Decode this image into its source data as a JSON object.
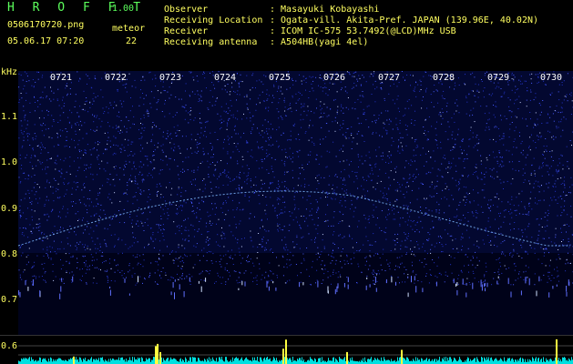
{
  "header": {
    "app_title": "H R O F F T",
    "app_version": "1.00",
    "filename": "0506170720.png",
    "datetime": "05.06.17 07:20",
    "meteor_label": "meteor",
    "meteor_count": "22"
  },
  "info": [
    {
      "label": "Observer",
      "value": ": Masayuki Kobayashi"
    },
    {
      "label": "Receiving Location",
      "value": ": Ogata-vill. Akita-Pref. JAPAN (139.96E, 40.02N)"
    },
    {
      "label": "Receiver",
      "value": ": ICOM IC-575 53.7492(@LCD)MHz USB"
    },
    {
      "label": "Receiving antenna",
      "value": ": A504HB(yagi 4el)"
    }
  ],
  "axis": {
    "unit": "kHz",
    "y_ticks": [
      "1.1",
      "1.0",
      "0.9",
      "0.8",
      "0.7"
    ],
    "x_ticks": [
      "0721",
      "0722",
      "0723",
      "0724",
      "0725",
      "0726",
      "0727",
      "0728",
      "0729",
      "0730"
    ],
    "lower_tick": "0.6"
  },
  "colors": {
    "background": "#000000",
    "spectrogram_noise": "#1a2a9a",
    "signal_line": "#7fb8ff",
    "graph_base": "#00e0e0",
    "graph_peak": "#ffff40",
    "label_yellow": "#ffff60",
    "label_green": "#5cff5c"
  }
}
